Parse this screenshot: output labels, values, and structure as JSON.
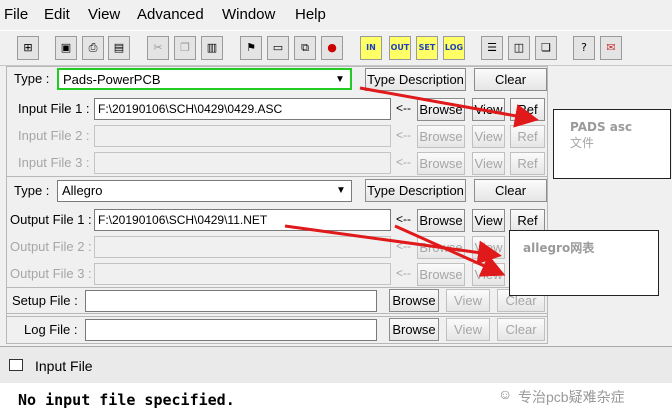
{
  "menu": [
    "File",
    "Edit",
    "View",
    "Advanced",
    "Window",
    "Help"
  ],
  "toolbar": {
    "icons": [
      "network-icon",
      "save-icon",
      "print-icon",
      "print-preview-icon",
      "cut-icon",
      "copy-icon",
      "paste-icon",
      "run-icon",
      "open-file-icon",
      "open-files-icon",
      "stop-icon",
      "in-icon",
      "out-icon",
      "set-icon",
      "log-icon",
      "horizontal-split-icon",
      "vertical-split-icon",
      "cascade-icon",
      "help-icon",
      "about-icon"
    ],
    "words": {
      "in": "IN",
      "out": "OUT",
      "set": "SET",
      "log": "LOG"
    }
  },
  "input": {
    "type_label": "Type :",
    "type_value": "Pads-PowerPCB",
    "type_desc": "Type Description",
    "clear": "Clear",
    "rows": [
      {
        "label": "Input File 1 :",
        "value": "F:\\20190106\\SCH\\0429\\0429.ASC",
        "enabled": true
      },
      {
        "label": "Input File 2 :",
        "value": "",
        "enabled": false
      },
      {
        "label": "Input File 3 :",
        "value": "",
        "enabled": false
      }
    ]
  },
  "output": {
    "type_label": "Type :",
    "type_value": "Allegro",
    "type_desc": "Type Description",
    "clear": "Clear",
    "rows": [
      {
        "label": "Output File 1 :",
        "value": "F:\\20190106\\SCH\\0429\\11.NET",
        "enabled": true
      },
      {
        "label": "Output File 2 :",
        "value": "",
        "enabled": false
      },
      {
        "label": "Output File 3 :",
        "value": "",
        "enabled": false
      }
    ]
  },
  "setup": {
    "label": "Setup File :",
    "value": "",
    "browse": "Browse",
    "view": "View",
    "clear": "Clear"
  },
  "log": {
    "label": "Log File :",
    "value": "",
    "browse": "Browse",
    "view": "View",
    "clear": "Clear"
  },
  "buttons": {
    "arrow": "<--",
    "browse": "Browse",
    "view": "View",
    "ref": "Ref"
  },
  "annotations": {
    "pads": {
      "line1": "PADS asc",
      "line2": "文件"
    },
    "allegro": "allegro网表"
  },
  "bottom_window": {
    "title": "Input File",
    "message": "No input file specified.",
    "watermark": "专治pcb疑难杂症"
  },
  "colors": {
    "highlight": "#22cc22",
    "arrow": "#e0191b"
  }
}
